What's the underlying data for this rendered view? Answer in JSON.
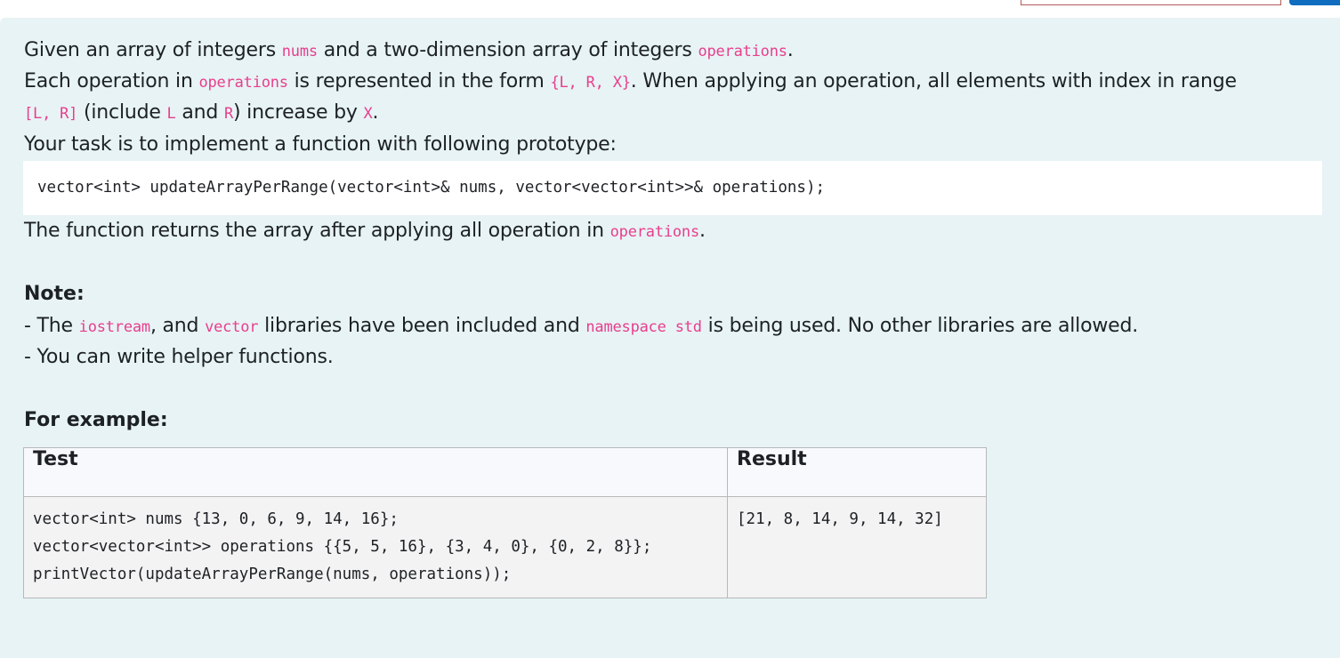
{
  "question": {
    "line1": {
      "t1": "Given an array of integers ",
      "c1": "nums",
      "t2": " and a two-dimension array of integers ",
      "c2": "operations",
      "t3": "."
    },
    "line2": {
      "t1": "Each operation in ",
      "c1": "operations",
      "t2": " is represented in the form ",
      "c2": "{L, R, X}",
      "t3": ". When applying an operation, all elements with index in range"
    },
    "line3": {
      "c1": "[L, R]",
      "t1": " (include ",
      "c2": "L",
      "t2": " and ",
      "c3": "R",
      "t3": ") increase by ",
      "c4": "X",
      "t4": "."
    },
    "line4": "Your task is to implement a function with following prototype:",
    "prototype": "vector<int> updateArrayPerRange(vector<int>& nums, vector<vector<int>>& operations);",
    "line5": {
      "t1": "The function returns the array after applying all operation in ",
      "c1": "operations",
      "t2": "."
    },
    "note_heading": "Note:",
    "note1": {
      "t1": "- The ",
      "c1": "iostream",
      "t2": ", and ",
      "c2": "vector",
      "t3": " libraries have been included and ",
      "c3": "namespace std",
      "t4": " is being used. No other libraries are allowed."
    },
    "note2": "- You can write helper functions.",
    "example_heading": "For example:"
  },
  "examples_table": {
    "headers": {
      "test": "Test",
      "result": "Result"
    },
    "rows": [
      {
        "test": "vector<int> nums {13, 0, 6, 9, 14, 16};\nvector<vector<int>> operations {{5, 5, 16}, {3, 4, 0}, {0, 2, 8}};\nprintVector(updateArrayPerRange(nums, operations));",
        "result": "[21, 8, 14, 9, 14, 32]"
      }
    ]
  },
  "colors": {
    "panel": "#e7f3f5",
    "inline_code": "#e83e8c",
    "button": "#0f6cbf"
  }
}
